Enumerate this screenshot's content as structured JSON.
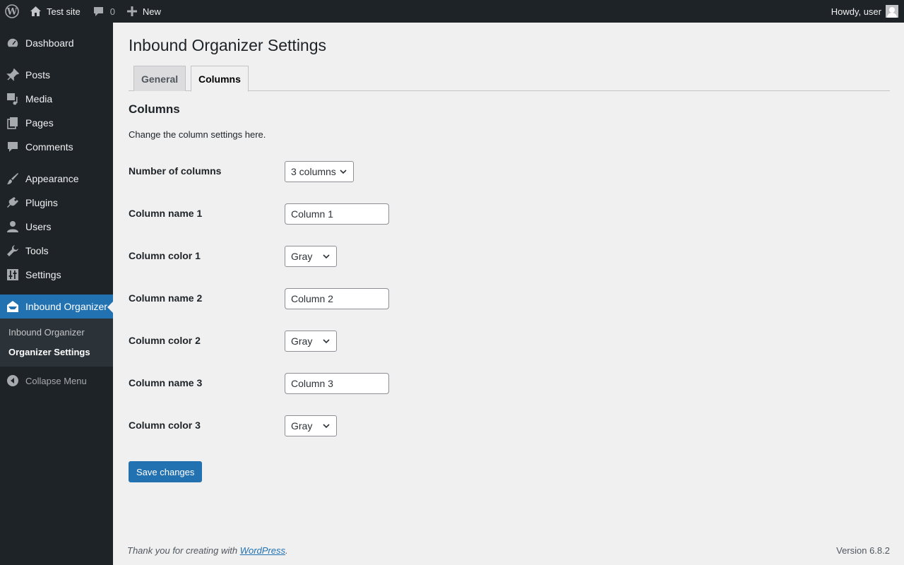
{
  "adminbar": {
    "site_name": "Test site",
    "comments_count": "0",
    "new_label": "New",
    "greeting": "Howdy, user"
  },
  "sidebar": {
    "items": [
      {
        "label": "Dashboard",
        "icon": "dashboard-icon"
      },
      {
        "label": "Posts",
        "icon": "pin-icon"
      },
      {
        "label": "Media",
        "icon": "media-icon"
      },
      {
        "label": "Pages",
        "icon": "pages-icon"
      },
      {
        "label": "Comments",
        "icon": "comment-icon"
      },
      {
        "label": "Appearance",
        "icon": "brush-icon"
      },
      {
        "label": "Plugins",
        "icon": "plug-icon"
      },
      {
        "label": "Users",
        "icon": "user-icon"
      },
      {
        "label": "Tools",
        "icon": "wrench-icon"
      },
      {
        "label": "Settings",
        "icon": "settings-icon"
      },
      {
        "label": "Inbound Organizer",
        "icon": "inbox-icon"
      }
    ],
    "submenu": [
      "Inbound Organizer",
      "Organizer Settings"
    ],
    "collapse_label": "Collapse Menu"
  },
  "page": {
    "title": "Inbound Organizer Settings",
    "tabs": [
      "General",
      "Columns"
    ],
    "section_title": "Columns",
    "section_desc": "Change the column settings here."
  },
  "form": {
    "num_columns_label": "Number of columns",
    "num_columns_value": "3 columns",
    "rows": [
      {
        "label": "Column name 1",
        "value": "Column 1"
      },
      {
        "label": "Column color 1",
        "value": "Gray"
      },
      {
        "label": "Column name 2",
        "value": "Column 2"
      },
      {
        "label": "Column color 2",
        "value": "Gray"
      },
      {
        "label": "Column name 3",
        "value": "Column 3"
      },
      {
        "label": "Column color 3",
        "value": "Gray"
      }
    ],
    "save_label": "Save changes"
  },
  "footer": {
    "thanks_prefix": "Thank you for creating with ",
    "thanks_link": "WordPress",
    "thanks_suffix": ".",
    "version": "Version 6.8.2"
  },
  "colors": {
    "adminbar_bg": "#1d2327",
    "accent": "#2271b1",
    "page_bg": "#f0f0f1"
  }
}
